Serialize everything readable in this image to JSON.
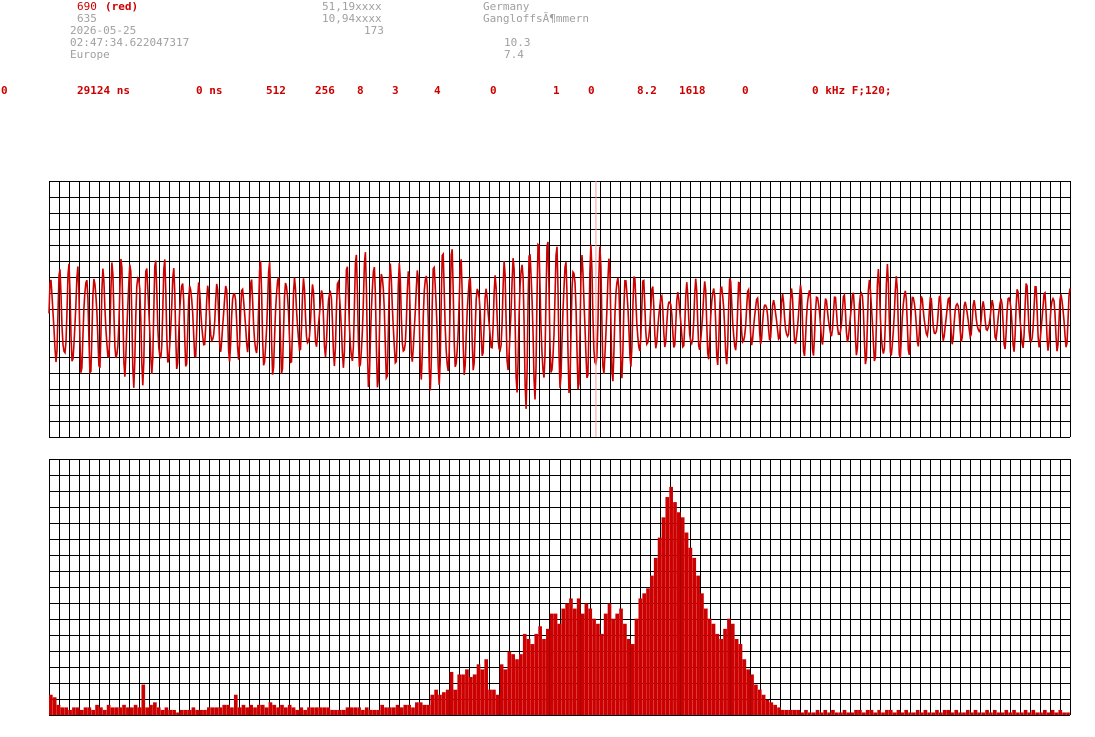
{
  "header": {
    "station_id": "690",
    "station_color": "(red)",
    "code": "635",
    "date": "2026-05-25",
    "time": "02:47:34.622047317",
    "region": "Europe",
    "lat": "51,19xxxx",
    "lon": "10,94xxxx",
    "alt": "173",
    "country": "Germany",
    "place": "GangloffsÃ¶mmern",
    "val1": "10.3",
    "val2": "7.4"
  },
  "params": {
    "p0": "0",
    "p1": "29124 ns",
    "p2": "0 ns",
    "p3": "512",
    "p4": "256",
    "p5": "8",
    "p6": "3",
    "p7": "4",
    "p8": "0",
    "p9": "1",
    "p10": "0",
    "p11": "8.2",
    "p12": "1618",
    "p13": "0",
    "p14": "0 kHz F;120;"
  },
  "colors": {
    "series": "#cc0000",
    "grid": "#000000",
    "marker": "#ff9999"
  },
  "chart_data": [
    {
      "type": "line",
      "grid": true,
      "ylim": [
        -1,
        1
      ],
      "x": [
        0,
        1023
      ],
      "envelope": [
        [
          0,
          0.45
        ],
        [
          30,
          0.55
        ],
        [
          60,
          0.5
        ],
        [
          80,
          0.65
        ],
        [
          100,
          0.6
        ],
        [
          120,
          0.55
        ],
        [
          140,
          0.45
        ],
        [
          160,
          0.3
        ],
        [
          180,
          0.4
        ],
        [
          200,
          0.35
        ],
        [
          215,
          0.6
        ],
        [
          230,
          0.55
        ],
        [
          250,
          0.4
        ],
        [
          270,
          0.3
        ],
        [
          300,
          0.55
        ],
        [
          320,
          0.7
        ],
        [
          340,
          0.6
        ],
        [
          360,
          0.45
        ],
        [
          380,
          0.65
        ],
        [
          400,
          0.7
        ],
        [
          420,
          0.55
        ],
        [
          440,
          0.3
        ],
        [
          460,
          0.6
        ],
        [
          480,
          0.85
        ],
        [
          500,
          0.75
        ],
        [
          520,
          0.7
        ],
        [
          540,
          0.7
        ],
        [
          560,
          0.65
        ],
        [
          580,
          0.5
        ],
        [
          600,
          0.35
        ],
        [
          620,
          0.25
        ],
        [
          640,
          0.35
        ],
        [
          660,
          0.4
        ],
        [
          680,
          0.45
        ],
        [
          700,
          0.3
        ],
        [
          720,
          0.2
        ],
        [
          740,
          0.25
        ],
        [
          760,
          0.4
        ],
        [
          780,
          0.2
        ],
        [
          800,
          0.25
        ],
        [
          820,
          0.45
        ],
        [
          840,
          0.5
        ],
        [
          860,
          0.35
        ],
        [
          880,
          0.2
        ],
        [
          900,
          0.25
        ],
        [
          920,
          0.2
        ],
        [
          940,
          0.15
        ],
        [
          960,
          0.3
        ],
        [
          980,
          0.35
        ],
        [
          1000,
          0.3
        ],
        [
          1023,
          0.3
        ]
      ],
      "marker_x": 548
    },
    {
      "type": "bar",
      "grid": true,
      "ylim": [
        0,
        1
      ],
      "values": [
        0.08,
        0.07,
        0.04,
        0.03,
        0.03,
        0.02,
        0.03,
        0.03,
        0.02,
        0.03,
        0.03,
        0.02,
        0.04,
        0.03,
        0.02,
        0.04,
        0.03,
        0.03,
        0.03,
        0.04,
        0.03,
        0.03,
        0.04,
        0.03,
        0.12,
        0.03,
        0.04,
        0.05,
        0.03,
        0.02,
        0.03,
        0.02,
        0.02,
        0.01,
        0.02,
        0.02,
        0.02,
        0.03,
        0.02,
        0.02,
        0.02,
        0.03,
        0.03,
        0.03,
        0.03,
        0.04,
        0.04,
        0.03,
        0.08,
        0.03,
        0.04,
        0.03,
        0.04,
        0.03,
        0.04,
        0.04,
        0.03,
        0.05,
        0.04,
        0.03,
        0.04,
        0.03,
        0.04,
        0.03,
        0.02,
        0.03,
        0.02,
        0.03,
        0.03,
        0.03,
        0.03,
        0.03,
        0.03,
        0.02,
        0.02,
        0.02,
        0.02,
        0.03,
        0.03,
        0.03,
        0.03,
        0.02,
        0.03,
        0.02,
        0.02,
        0.02,
        0.04,
        0.03,
        0.03,
        0.03,
        0.04,
        0.03,
        0.04,
        0.04,
        0.03,
        0.05,
        0.05,
        0.04,
        0.04,
        0.08,
        0.1,
        0.08,
        0.09,
        0.1,
        0.17,
        0.1,
        0.16,
        0.16,
        0.18,
        0.15,
        0.16,
        0.2,
        0.18,
        0.22,
        0.1,
        0.1,
        0.08,
        0.2,
        0.18,
        0.25,
        0.24,
        0.22,
        0.24,
        0.32,
        0.3,
        0.28,
        0.32,
        0.35,
        0.3,
        0.34,
        0.4,
        0.4,
        0.36,
        0.42,
        0.44,
        0.46,
        0.42,
        0.46,
        0.4,
        0.44,
        0.42,
        0.38,
        0.36,
        0.32,
        0.4,
        0.44,
        0.38,
        0.4,
        0.42,
        0.36,
        0.3,
        0.28,
        0.38,
        0.46,
        0.48,
        0.5,
        0.55,
        0.62,
        0.7,
        0.78,
        0.86,
        0.9,
        0.84,
        0.8,
        0.78,
        0.72,
        0.66,
        0.62,
        0.55,
        0.48,
        0.42,
        0.38,
        0.36,
        0.32,
        0.3,
        0.34,
        0.38,
        0.36,
        0.3,
        0.28,
        0.22,
        0.18,
        0.16,
        0.12,
        0.1,
        0.08,
        0.06,
        0.05,
        0.04,
        0.03,
        0.02,
        0.02,
        0.02,
        0.02,
        0.02,
        0.01,
        0.02,
        0.01,
        0.01,
        0.02,
        0.01,
        0.02,
        0.01,
        0.02,
        0.01,
        0.01,
        0.02,
        0.01,
        0.01,
        0.02,
        0.02,
        0.01,
        0.02,
        0.02,
        0.01,
        0.02,
        0.01,
        0.02,
        0.02,
        0.01,
        0.02,
        0.01,
        0.02,
        0.01,
        0.01,
        0.02,
        0.01,
        0.02,
        0.01,
        0.01,
        0.02,
        0.01,
        0.02,
        0.02,
        0.01,
        0.02,
        0.01,
        0.01,
        0.02,
        0.01,
        0.02,
        0.01,
        0.01,
        0.02,
        0.01,
        0.02,
        0.01,
        0.01,
        0.02,
        0.01,
        0.02,
        0.01,
        0.01,
        0.02,
        0.01,
        0.02,
        0.01,
        0.01,
        0.02,
        0.01,
        0.02,
        0.01,
        0.02,
        0.01,
        0.01
      ]
    }
  ]
}
